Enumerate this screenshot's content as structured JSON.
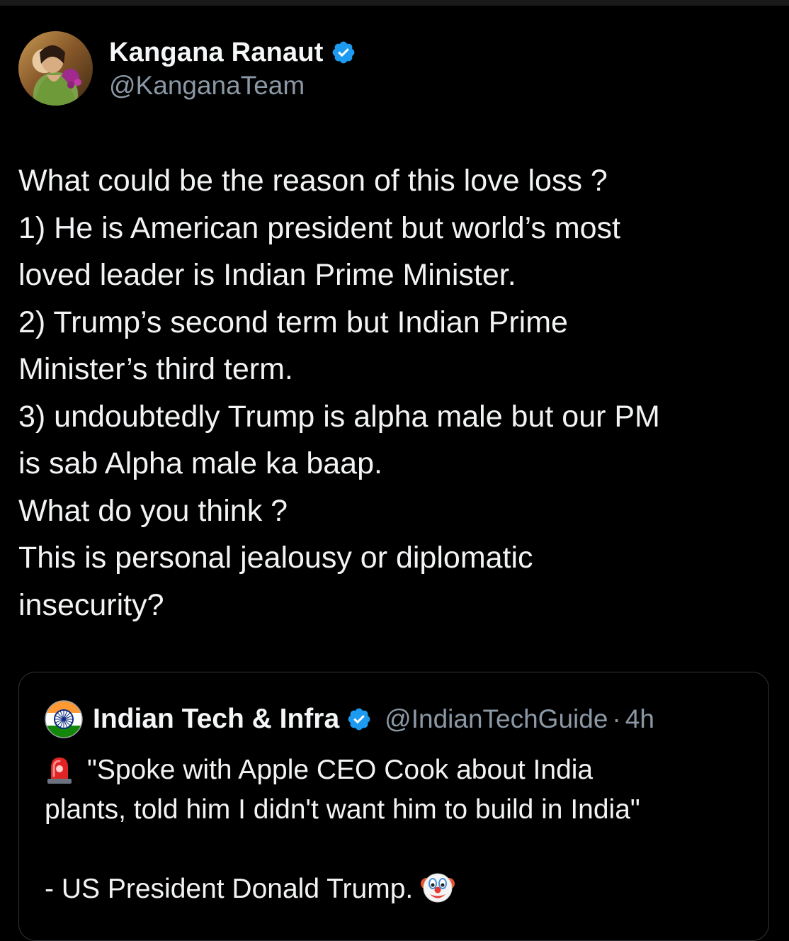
{
  "author": {
    "name": "Kangana Ranaut",
    "handle": "@KanganaTeam",
    "verified": true,
    "avatar_icon": "profile-photo"
  },
  "tweet": {
    "lines": [
      "What could be the reason of this love loss ?",
      "1) He is American president but world’s most",
      "loved leader is Indian Prime Minister.",
      "2) Trump’s second term but Indian Prime",
      "Minister’s third term.",
      "3) undoubtedly Trump is alpha male but our PM",
      "is sab Alpha male ka baap.",
      "What do you think ?",
      "This is personal jealousy or diplomatic",
      "insecurity?"
    ]
  },
  "quote": {
    "name": "Indian Tech & Infra",
    "handle": "@IndianTechGuide",
    "separator": "·",
    "time": "4h",
    "verified": true,
    "avatar_icon": "ashoka-chakra-flag",
    "lines": [
      {
        "prefix_icon": "police-siren-emoji",
        "text": "\"Spoke with Apple CEO Cook about India"
      },
      {
        "text": "plants, told him I didn't want him to build in India\""
      },
      {
        "text": ""
      },
      {
        "text": "- US President Donald Trump.",
        "suffix_icon": "clown-face-emoji"
      }
    ]
  },
  "colors": {
    "background": "#000000",
    "text": "#f2f3f4",
    "secondary_text": "#8b98a5",
    "verified_blue": "#1d9bf0",
    "card_border": "#2f3336"
  }
}
